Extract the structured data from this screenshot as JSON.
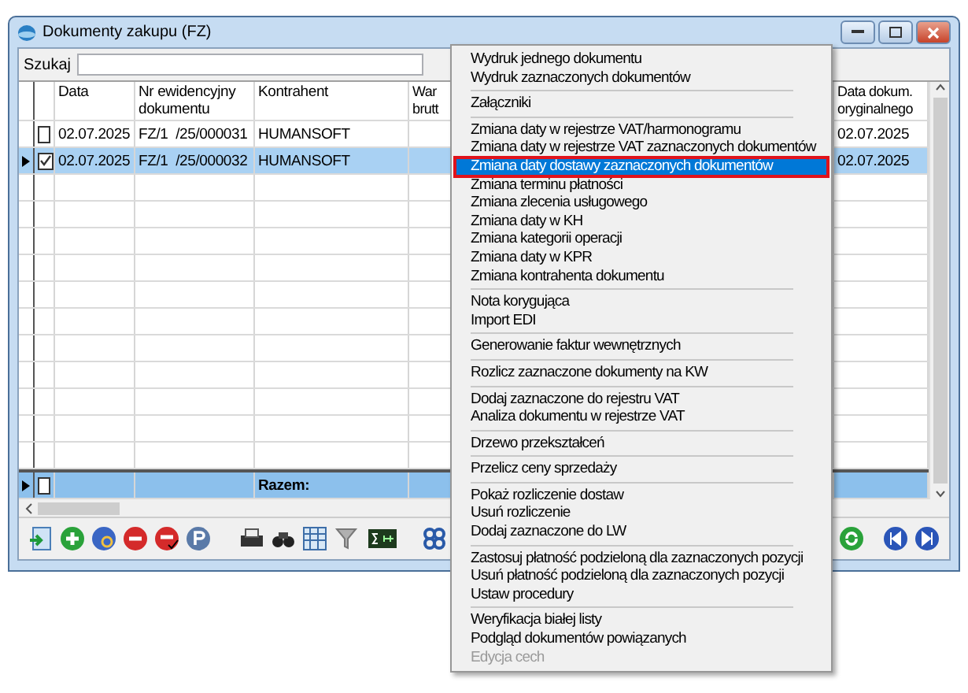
{
  "window": {
    "title": "Dokumenty zakupu (FZ)"
  },
  "search": {
    "label": "Szukaj"
  },
  "table": {
    "columns": [
      {
        "label": "Data"
      },
      {
        "label": "Nr ewidencyjny dokumentu"
      },
      {
        "label": "Kontrahent"
      },
      {
        "label": "War brutt"
      },
      {
        "label": "Data dokum. oryginalnego"
      }
    ],
    "rows": [
      {
        "checked": false,
        "selected": false,
        "date": "02.07.2025",
        "number": "FZ/1  /25/000031",
        "contractor": "HUMANSOFT",
        "original_date": "02.07.2025"
      },
      {
        "checked": true,
        "selected": true,
        "date": "02.07.2025",
        "number": "FZ/1  /25/000032",
        "contractor": "HUMANSOFT",
        "original_date": "02.07.2025"
      }
    ],
    "totals": {
      "label": "Razem:",
      "checked": false
    }
  },
  "menu": {
    "groups": [
      [
        {
          "label": "Wydruk jednego dokumentu",
          "selected": false,
          "disabled": false
        },
        {
          "label": "Wydruk zaznaczonych dokumentów",
          "selected": false,
          "disabled": false
        }
      ],
      [
        {
          "label": "Załączniki",
          "selected": false,
          "disabled": false
        }
      ],
      [
        {
          "label": "Zmiana daty w rejestrze VAT/harmonogramu",
          "selected": false,
          "disabled": false
        },
        {
          "label": "Zmiana daty w rejestrze VAT zaznaczonych dokumentów",
          "selected": false,
          "disabled": false
        },
        {
          "label": "Zmiana daty dostawy zaznaczonych dokumentów",
          "selected": true,
          "disabled": false
        },
        {
          "label": "Zmiana terminu płatności",
          "selected": false,
          "disabled": false
        },
        {
          "label": "Zmiana zlecenia usługowego",
          "selected": false,
          "disabled": false
        },
        {
          "label": "Zmiana daty w KH",
          "selected": false,
          "disabled": false
        },
        {
          "label": "Zmiana kategorii operacji",
          "selected": false,
          "disabled": false
        },
        {
          "label": "Zmiana daty w KPR",
          "selected": false,
          "disabled": false
        },
        {
          "label": "Zmiana kontrahenta dokumentu",
          "selected": false,
          "disabled": false
        }
      ],
      [
        {
          "label": "Nota korygująca",
          "selected": false,
          "disabled": false
        },
        {
          "label": "Import EDI",
          "selected": false,
          "disabled": false
        }
      ],
      [
        {
          "label": "Generowanie faktur wewnętrznych",
          "selected": false,
          "disabled": false
        }
      ],
      [
        {
          "label": "Rozlicz zaznaczone dokumenty na KW",
          "selected": false,
          "disabled": false
        }
      ],
      [
        {
          "label": "Dodaj zaznaczone do rejestru VAT",
          "selected": false,
          "disabled": false
        },
        {
          "label": "Analiza dokumentu w rejestrze VAT",
          "selected": false,
          "disabled": false
        }
      ],
      [
        {
          "label": "Drzewo przekształceń",
          "selected": false,
          "disabled": false
        }
      ],
      [
        {
          "label": "Przelicz ceny sprzedaży",
          "selected": false,
          "disabled": false
        }
      ],
      [
        {
          "label": "Pokaż rozliczenie dostaw",
          "selected": false,
          "disabled": false
        },
        {
          "label": "Usuń rozliczenie",
          "selected": false,
          "disabled": false
        },
        {
          "label": "Dodaj zaznaczone do LW",
          "selected": false,
          "disabled": false
        }
      ],
      [
        {
          "label": "Zastosuj płatność podzieloną dla zaznaczonych pozycji",
          "selected": false,
          "disabled": false
        },
        {
          "label": "Usuń płatność podzieloną dla zaznaczonych pozycji",
          "selected": false,
          "disabled": false
        },
        {
          "label": "Ustaw procedury",
          "selected": false,
          "disabled": false
        }
      ],
      [
        {
          "label": "Weryfikacja białej listy",
          "selected": false,
          "disabled": false
        },
        {
          "label": "Podgląd dokumentów powiązanych",
          "selected": false,
          "disabled": false
        },
        {
          "label": "Edycja cech",
          "selected": false,
          "disabled": true
        }
      ]
    ]
  }
}
